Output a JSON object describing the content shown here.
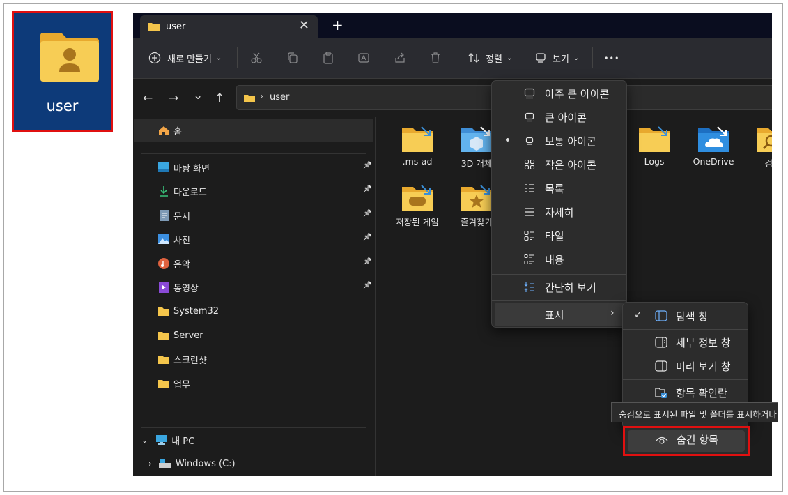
{
  "desktop": {
    "label": "user"
  },
  "tab": {
    "title": "user",
    "close": "✕",
    "new": "+"
  },
  "toolbar": {
    "new_label": "새로 만들기",
    "sort_label": "정렬",
    "view_label": "보기",
    "more": "•••"
  },
  "address": {
    "path": "user",
    "chevron": "›"
  },
  "nav": {
    "back": "←",
    "forward": "→",
    "recent": "⌄",
    "up": "↑"
  },
  "sidebar": {
    "home": "홈",
    "quick": [
      {
        "label": "바탕 화면",
        "icon": "desktop-icon",
        "pinned": true
      },
      {
        "label": "다운로드",
        "icon": "download-icon",
        "pinned": true
      },
      {
        "label": "문서",
        "icon": "document-icon",
        "pinned": true
      },
      {
        "label": "사진",
        "icon": "pictures-icon",
        "pinned": true
      },
      {
        "label": "음악",
        "icon": "music-icon",
        "pinned": true
      },
      {
        "label": "동영상",
        "icon": "video-icon",
        "pinned": true
      },
      {
        "label": "System32",
        "icon": "folder-icon",
        "pinned": false
      },
      {
        "label": "Server",
        "icon": "folder-icon",
        "pinned": false
      },
      {
        "label": "스크린샷",
        "icon": "folder-icon",
        "pinned": false
      },
      {
        "label": "업무",
        "icon": "folder-icon",
        "pinned": false
      }
    ],
    "this_pc": "내 PC",
    "drive": "Windows (C:)"
  },
  "content": {
    "items": [
      {
        "label": ".ms-ad",
        "icon": "folder-icon"
      },
      {
        "label": "3D 개체",
        "icon": "3d-objects-icon"
      },
      {
        "label": "Logs",
        "icon": "folder-icon"
      },
      {
        "label": "OneDrive",
        "icon": "onedrive-icon"
      },
      {
        "label": "검색",
        "icon": "search-folder-icon"
      },
      {
        "label": "저장된 게임",
        "icon": "saved-games-icon"
      },
      {
        "label": "즐겨찾기",
        "icon": "favorites-icon"
      }
    ]
  },
  "view_menu": {
    "items": [
      "아주 큰 아이콘",
      "큰 아이콘",
      "보통 아이콘",
      "작은 아이콘",
      "목록",
      "자세히",
      "타일",
      "내용",
      "간단히 보기",
      "표시"
    ],
    "selected": "보통 아이콘"
  },
  "show_menu": {
    "items": [
      "탐색 창",
      "세부 정보 창",
      "미리 보기 창",
      "항목 확인란",
      "숨긴 항목"
    ],
    "checked": "탐색 창"
  },
  "tooltip": "숨김으로 표시된 파일 및 폴더를 표시하거나 숨깁니다.",
  "colors": {
    "folder": "#f4c54b",
    "highlight_border": "#e01010",
    "desktop_bg": "#0d3a79"
  }
}
